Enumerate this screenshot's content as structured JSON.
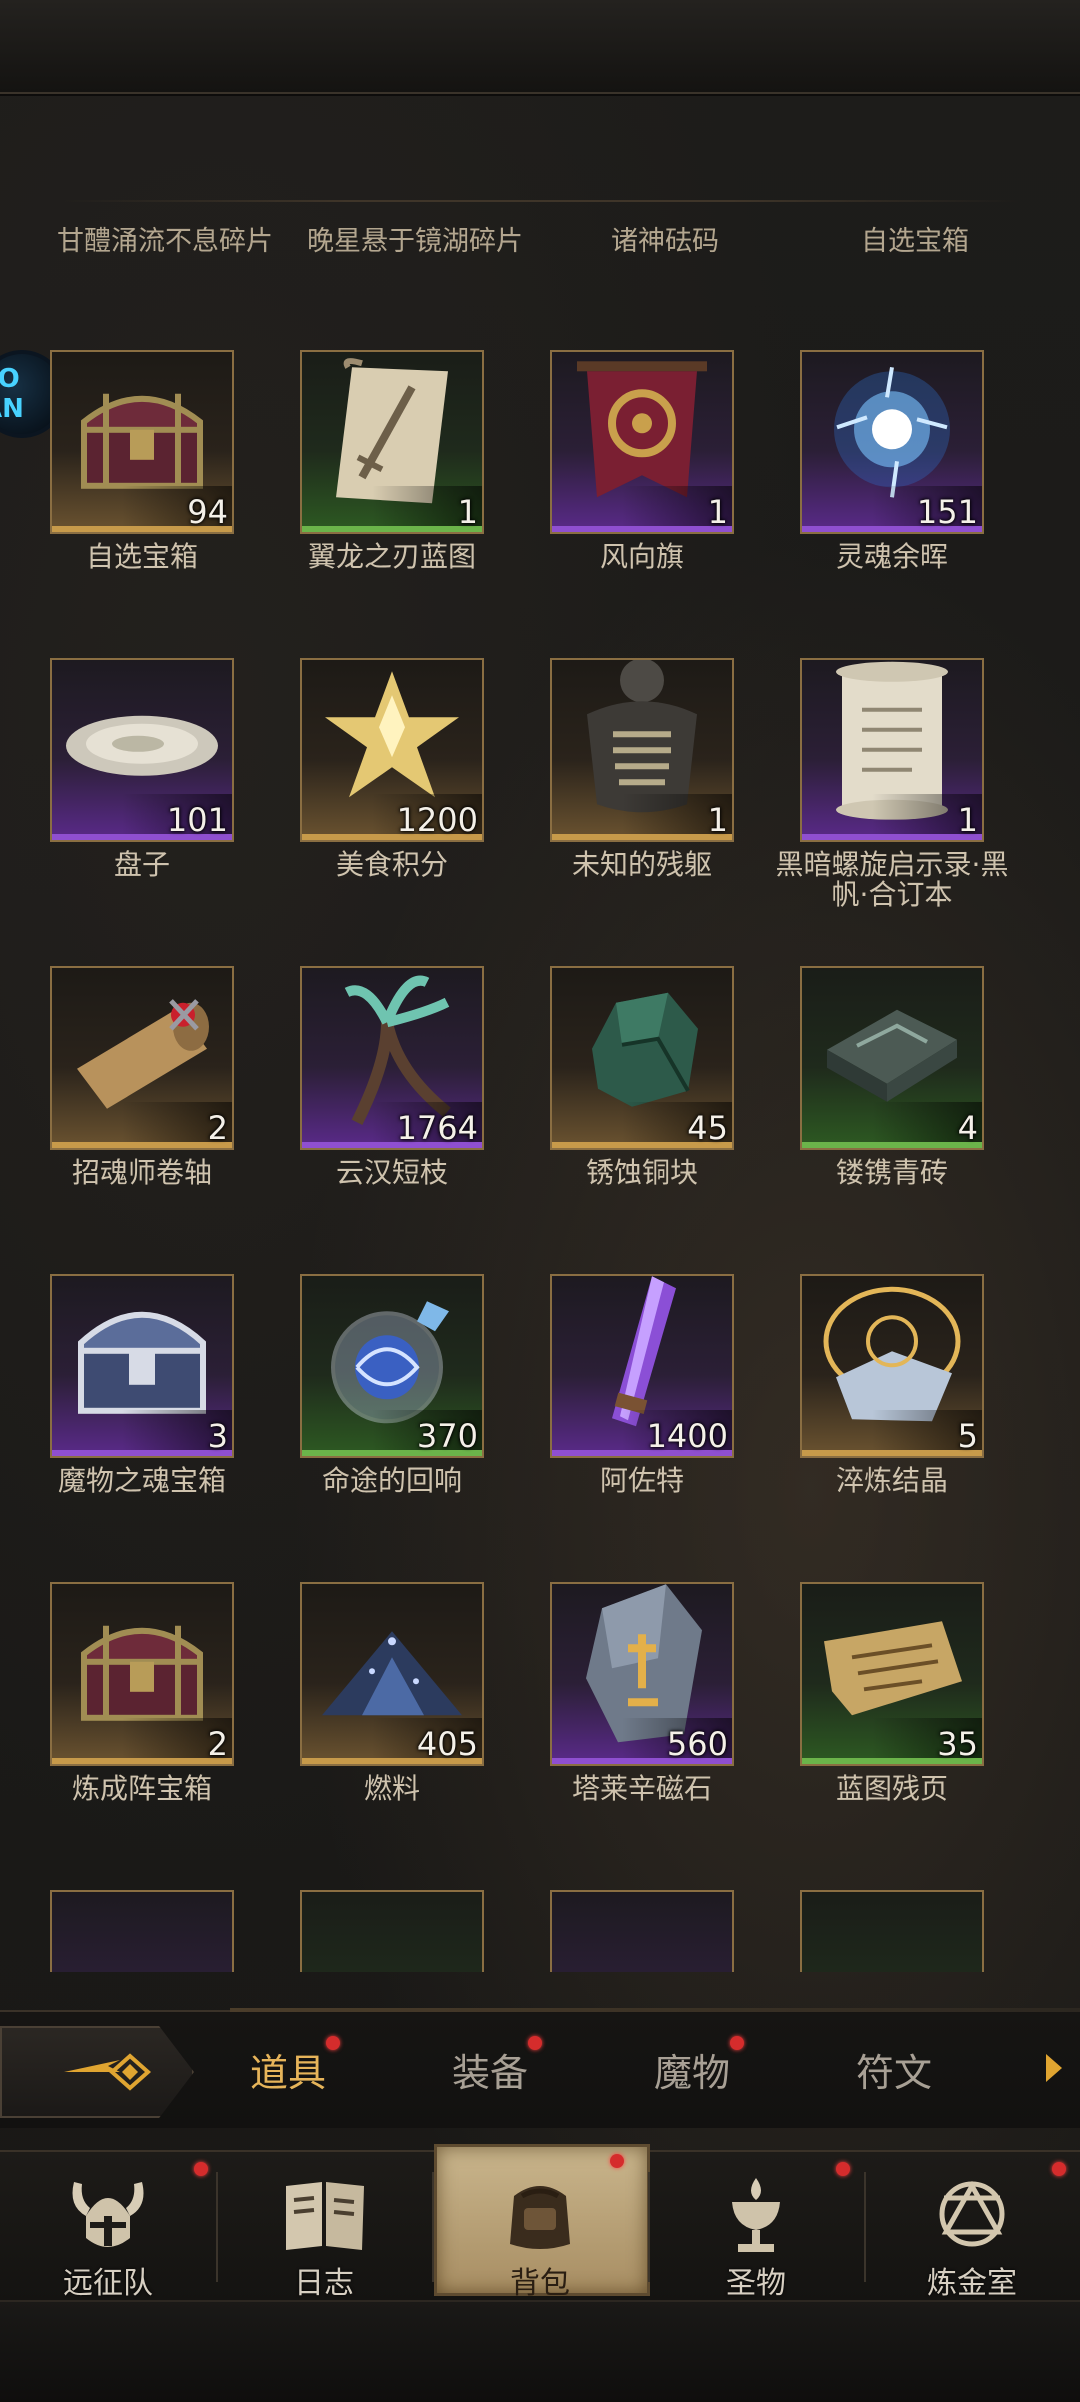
{
  "header_items": [
    "甘醴涌流不息碎片",
    "晚星悬于镜湖碎片",
    "诸神砝码",
    "自选宝箱"
  ],
  "items": [
    {
      "name": "自选宝箱",
      "count": "94",
      "rarity": "gold",
      "icon": "treasure-chest-icon"
    },
    {
      "name": "翼龙之刃蓝图",
      "count": "1",
      "rarity": "green",
      "icon": "blueprint-scroll-icon"
    },
    {
      "name": "风向旗",
      "count": "1",
      "rarity": "purple",
      "icon": "banner-icon"
    },
    {
      "name": "灵魂余晖",
      "count": "151",
      "rarity": "purple",
      "icon": "soul-orb-icon"
    },
    {
      "name": "盘子",
      "count": "101",
      "rarity": "purple",
      "icon": "plate-icon"
    },
    {
      "name": "美食积分",
      "count": "1200",
      "rarity": "gold",
      "icon": "star-crystal-icon"
    },
    {
      "name": "未知的残躯",
      "count": "1",
      "rarity": "gold",
      "icon": "torso-icon"
    },
    {
      "name": "黑暗螺旋启示录·黑帆·合订本",
      "count": "1",
      "rarity": "purple",
      "icon": "scroll-icon"
    },
    {
      "name": "招魂师卷轴",
      "count": "2",
      "rarity": "gold",
      "icon": "summoner-scroll-icon"
    },
    {
      "name": "云汉短枝",
      "count": "1764",
      "rarity": "purple",
      "icon": "branch-icon"
    },
    {
      "name": "锈蚀铜块",
      "count": "45",
      "rarity": "gold",
      "icon": "copper-ore-icon"
    },
    {
      "name": "镂镌青砖",
      "count": "4",
      "rarity": "green",
      "icon": "carved-brick-icon"
    },
    {
      "name": "魔物之魂宝箱",
      "count": "3",
      "rarity": "purple",
      "icon": "monster-chest-icon"
    },
    {
      "name": "命途的回响",
      "count": "370",
      "rarity": "green",
      "icon": "potion-orb-icon"
    },
    {
      "name": "阿佐特",
      "count": "1400",
      "rarity": "purple",
      "icon": "crystal-vial-icon"
    },
    {
      "name": "淬炼结晶",
      "count": "5",
      "rarity": "gold",
      "icon": "rune-crystal-icon"
    },
    {
      "name": "炼成阵宝箱",
      "count": "2",
      "rarity": "gold",
      "icon": "treasure-chest-icon"
    },
    {
      "name": "燃料",
      "count": "405",
      "rarity": "gold",
      "icon": "fuel-pile-icon"
    },
    {
      "name": "塔莱辛磁石",
      "count": "560",
      "rarity": "purple",
      "icon": "magnet-stone-icon"
    },
    {
      "name": "蓝图残页",
      "count": "35",
      "rarity": "green",
      "icon": "torn-page-icon"
    },
    {
      "name": "",
      "count": "",
      "rarity": "purple",
      "icon": "crystal-pile-icon"
    },
    {
      "name": "",
      "count": "",
      "rarity": "green",
      "icon": "green-potion-icon"
    },
    {
      "name": "",
      "count": "",
      "rarity": "purple",
      "icon": "ice-crystal-icon"
    },
    {
      "name": "",
      "count": "",
      "rarity": "green",
      "icon": "ice-ore-icon"
    }
  ],
  "tabs": {
    "items": [
      "道具",
      "装备",
      "魔物",
      "符文"
    ],
    "active": 0
  },
  "nav": {
    "items": [
      "远征队",
      "日志",
      "背包",
      "圣物",
      "炼金室"
    ],
    "active": 2
  },
  "avatar_text": "LO AN",
  "colors": {
    "accent": "#e6b45a",
    "badge_red": "#d52c2c"
  }
}
